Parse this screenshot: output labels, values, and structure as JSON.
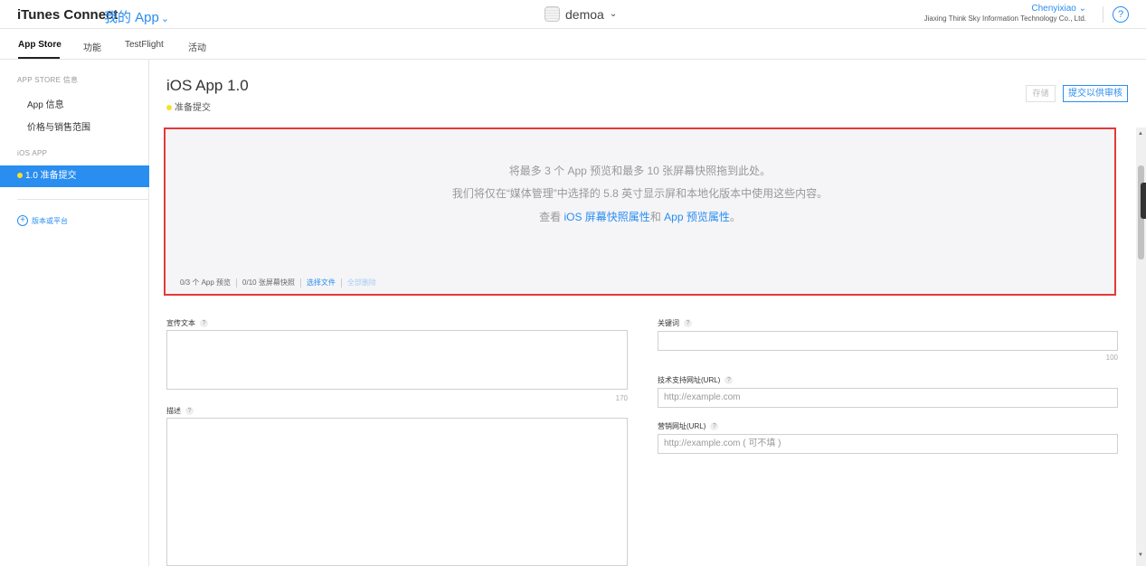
{
  "topbar": {
    "brand": "iTunes Connect",
    "my_app": "我的 App",
    "app_name": "demoa",
    "user_name": "Chenyixiao",
    "company": "Jiaxing Think Sky Information Technology Co., Ltd.",
    "help": "?"
  },
  "tabs": [
    {
      "label": "App Store"
    },
    {
      "label": "功能"
    },
    {
      "label": "TestFlight"
    },
    {
      "label": "活动"
    }
  ],
  "sidebar": {
    "section1": "APP STORE 信息",
    "items": [
      {
        "label": "App 信息"
      },
      {
        "label": "价格与销售范围"
      }
    ],
    "section2": "iOS APP",
    "active_item": "1.0 准备提交",
    "add_platform": "版本或平台"
  },
  "header": {
    "title": "iOS App 1.0",
    "status": "准备提交",
    "save_label": "存储",
    "submit_label": "提交以供审核"
  },
  "dropzone": {
    "line1": "将最多 3 个 App 预览和最多 10 张屏幕快照拖到此处。",
    "line2": "我们将仅在“媒体管理”中选择的 5.8 英寸显示屏和本地化版本中使用这些内容。",
    "line3_prefix": "查看 ",
    "line3_link1": "iOS 屏幕快照属性",
    "line3_mid": "和 ",
    "line3_link2": "App 预览属性",
    "line3_suffix": "。",
    "previews_count": "0/3 个 App 预览",
    "screenshots_count": "0/10 张屏幕快照",
    "choose_file": "选择文件",
    "delete_all": "全部删除"
  },
  "form": {
    "promo_label": "宣传文本",
    "promo_counter": "170",
    "desc_label": "描述",
    "keywords_label": "关键词",
    "keywords_counter": "100",
    "support_url_label": "技术支持网址(URL)",
    "support_url_placeholder": "http://example.com",
    "marketing_url_label": "营销网址(URL)",
    "marketing_url_placeholder": "http://example.com ( 可不填 )",
    "help_mark": "?"
  },
  "colors": {
    "accent": "#2a8df0",
    "highlight_border": "#e53935",
    "status_dot": "#f5e12b"
  }
}
